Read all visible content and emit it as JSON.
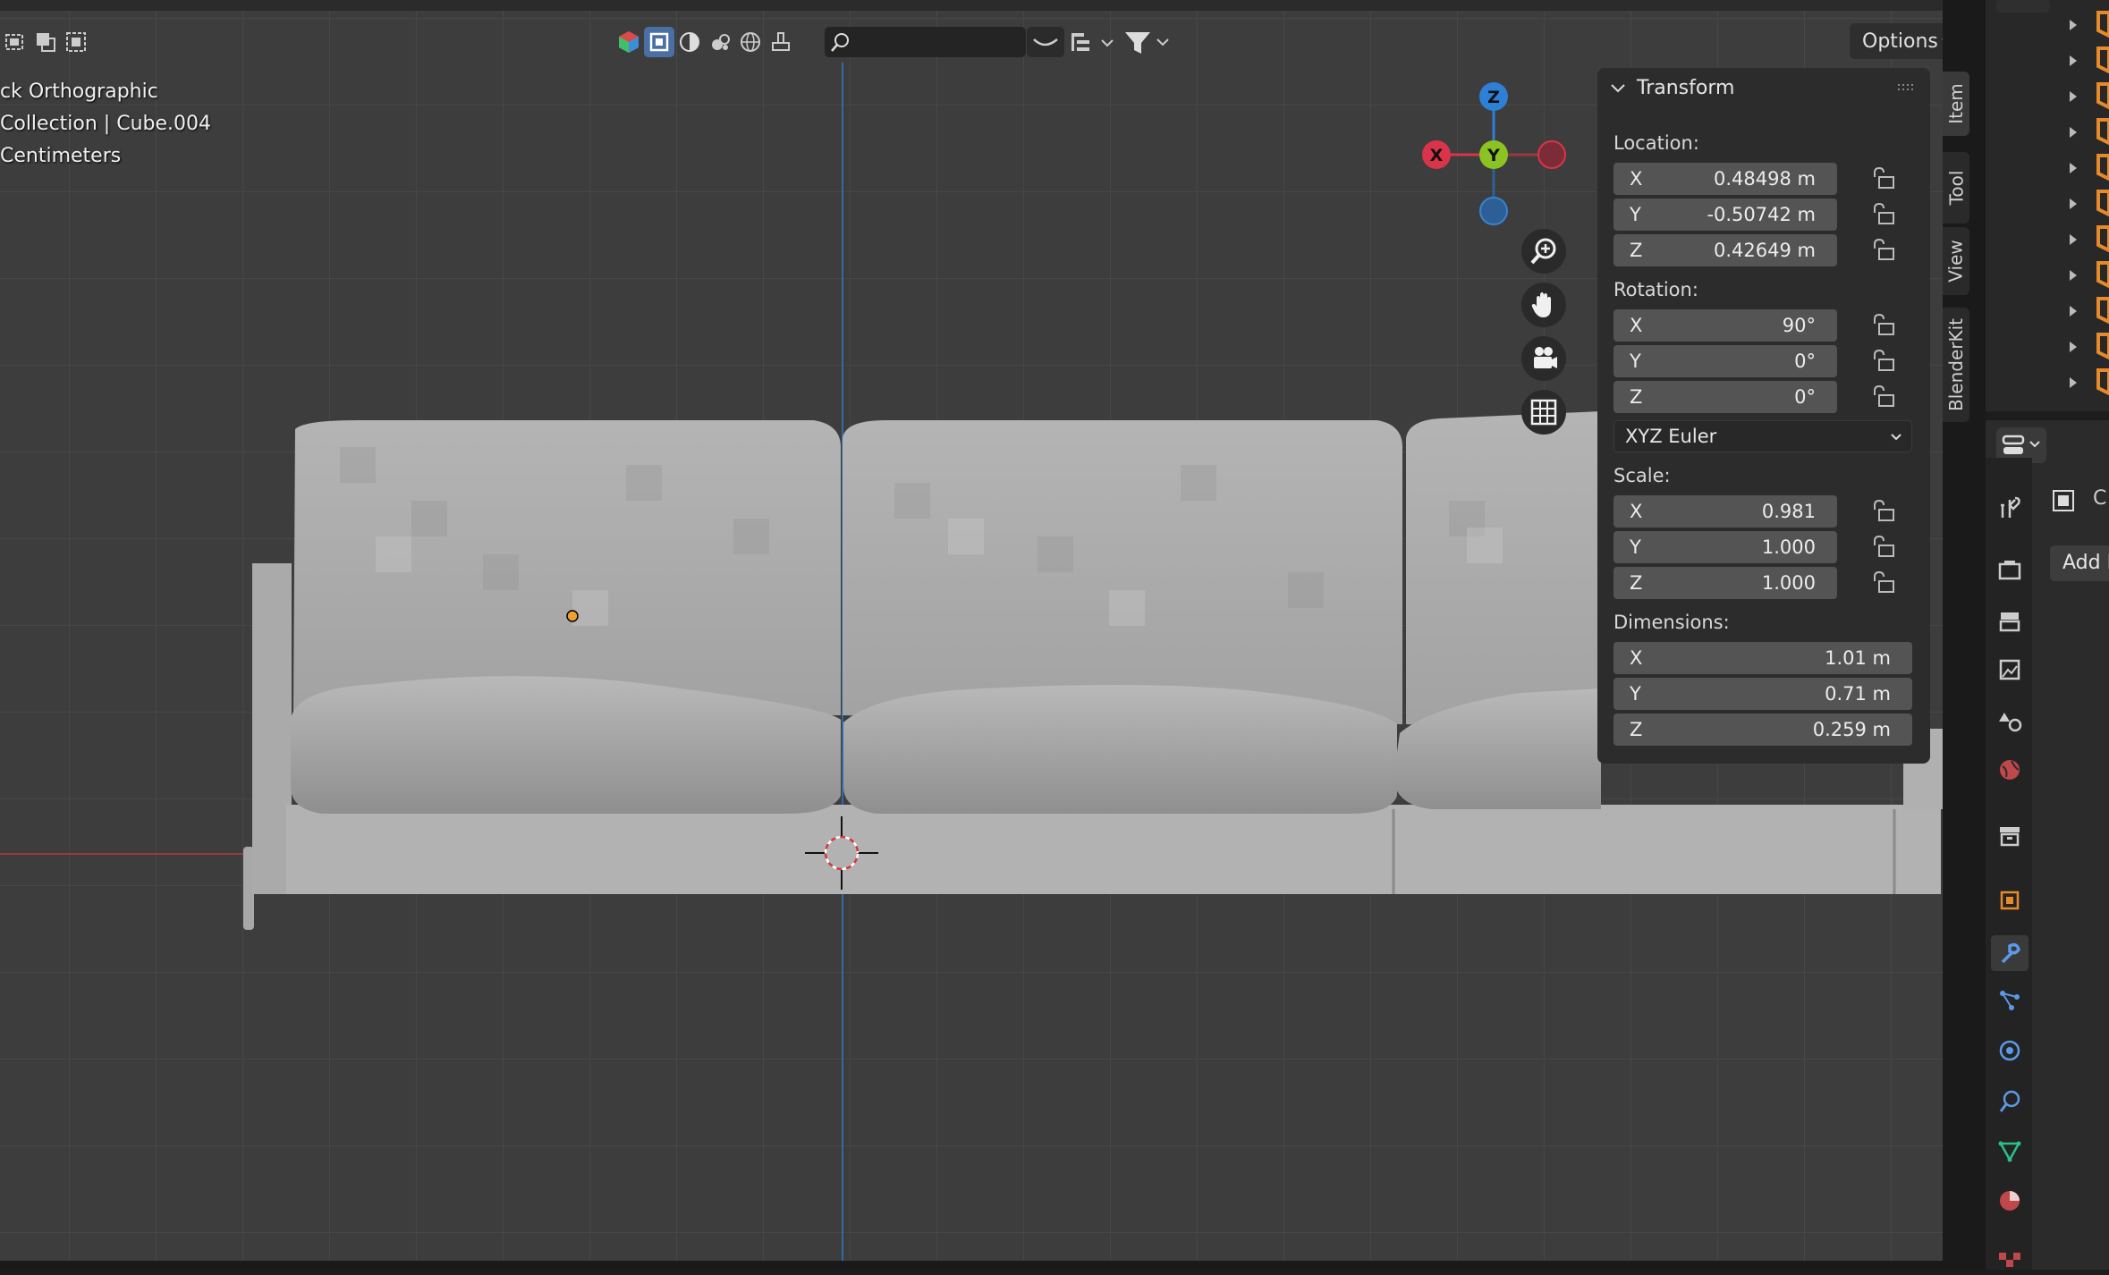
{
  "viewport": {
    "info_lines": [
      "ck Orthographic",
      " Collection | Cube.004",
      " Centimeters"
    ],
    "options_label": "Options"
  },
  "transform_panel": {
    "title": "Transform",
    "location_label": "Location:",
    "location": [
      {
        "axis": "X",
        "value": "0.48498 m"
      },
      {
        "axis": "Y",
        "value": "-0.50742 m"
      },
      {
        "axis": "Z",
        "value": "0.42649 m"
      }
    ],
    "rotation_label": "Rotation:",
    "rotation": [
      {
        "axis": "X",
        "value": "90°"
      },
      {
        "axis": "Y",
        "value": "0°"
      },
      {
        "axis": "Z",
        "value": "0°"
      }
    ],
    "rotation_mode": "XYZ Euler",
    "scale_label": "Scale:",
    "scale": [
      {
        "axis": "X",
        "value": "0.981"
      },
      {
        "axis": "Y",
        "value": "1.000"
      },
      {
        "axis": "Z",
        "value": "1.000"
      }
    ],
    "dimensions_label": "Dimensions:",
    "dimensions": [
      {
        "axis": "X",
        "value": "1.01 m"
      },
      {
        "axis": "Y",
        "value": "0.71 m"
      },
      {
        "axis": "Z",
        "value": "0.259 m"
      }
    ]
  },
  "sidebar_tabs": [
    "Item",
    "Tool",
    "View",
    "BlenderKit"
  ],
  "gizmo": {
    "x": "X",
    "y": "Y",
    "z": "Z"
  },
  "properties": {
    "header_char": "C",
    "add_button": "Add I"
  },
  "colors": {
    "accent": "#4a6fa5",
    "x_axis": "#d9344a",
    "y_axis": "#8bc322",
    "z_axis": "#2e7fd6",
    "origin": "#f0a030"
  }
}
